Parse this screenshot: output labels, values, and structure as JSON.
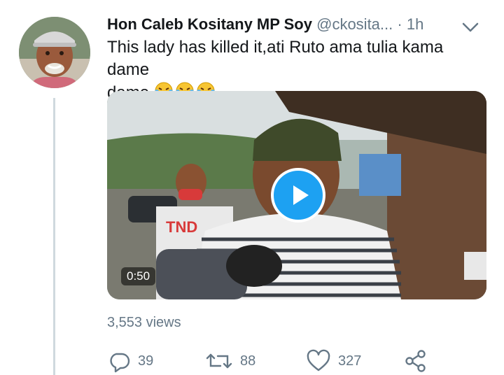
{
  "tweet": {
    "author_name": "Hon Caleb Kositany MP Soy",
    "handle": "@ckosita...",
    "separator": "·",
    "time": "1h",
    "text": "This lady has killed it,ati Ruto ama tulia kama dame",
    "text_end": ".",
    "emoji": [
      "😂",
      "😂",
      "😂"
    ],
    "video": {
      "duration": "0:50",
      "overlay_text": "TND"
    },
    "views": "3,553 views",
    "actions": {
      "reply_count": "39",
      "retweet_count": "88",
      "like_count": "327"
    },
    "icons": [
      "chevron-down-icon",
      "play-icon",
      "reply-icon",
      "retweet-icon",
      "like-icon",
      "share-icon"
    ]
  }
}
